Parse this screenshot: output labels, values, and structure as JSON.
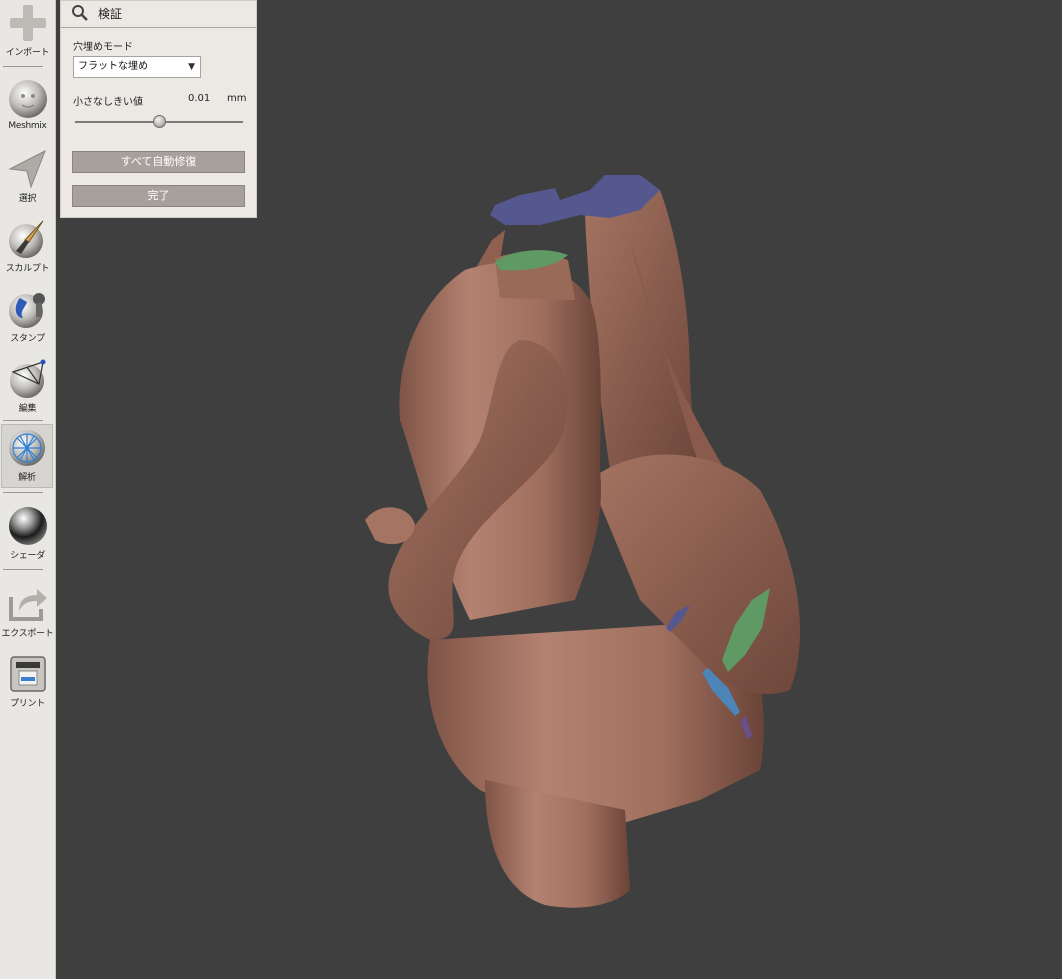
{
  "sidebar": {
    "items": [
      {
        "label": "インポート",
        "icon": "plus-icon"
      },
      {
        "label": "Meshmix",
        "icon": "meshmix-face-icon"
      },
      {
        "label": "選択",
        "icon": "select-arrow-icon"
      },
      {
        "label": "スカルプト",
        "icon": "sculpt-brush-icon"
      },
      {
        "label": "スタンプ",
        "icon": "stamp-icon"
      },
      {
        "label": "編集",
        "icon": "edit-mesh-icon"
      },
      {
        "label": "解析",
        "icon": "analysis-icon",
        "active": true
      },
      {
        "label": "シェーダ",
        "icon": "shader-sphere-icon"
      },
      {
        "label": "エクスポート",
        "icon": "export-icon"
      },
      {
        "label": "プリント",
        "icon": "print-icon"
      }
    ]
  },
  "panel": {
    "title": "検証",
    "hole_fill_label": "穴埋めモード",
    "hole_fill_value": "フラットな埋め",
    "threshold_label": "小さなしきい値",
    "threshold_value": "0.01",
    "threshold_unit": "mm",
    "slider_level": 0.5,
    "auto_repair_label": "すべて自動修復",
    "done_label": "完了"
  },
  "colors": {
    "viewport_bg": "#3f3f3f",
    "model": "#a87563",
    "open_boundary_blue": "#55588f",
    "repair_green": "#5f9a64",
    "sidebar_bg": "#e9e7e4",
    "panel_bg": "#ece9e5",
    "button_bg": "#a8a09d"
  }
}
